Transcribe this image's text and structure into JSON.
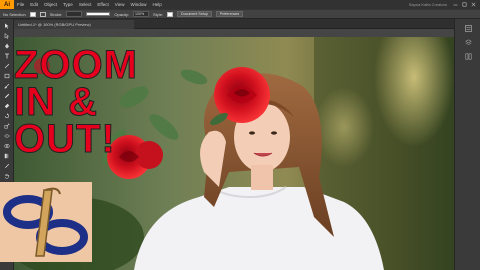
{
  "menubar": {
    "app_logo": "Ai",
    "items": [
      "File",
      "Edit",
      "Object",
      "Type",
      "Select",
      "Effect",
      "View",
      "Window",
      "Help"
    ],
    "workspace": "Sapna Kalfa Creators"
  },
  "controlbar": {
    "selection_label": "No Selection",
    "stroke_label": "Stroke:",
    "opacity_label": "Opacity:",
    "opacity_value": "100%",
    "style_label": "Style:",
    "document_setup": "Document Setup",
    "preferences": "Preferences"
  },
  "document_tab": {
    "label": "Untitled-1* @ 100% (RGB/GPU Preview)"
  },
  "overlay": {
    "line1": "ZOOM",
    "line2": "IN &",
    "line3": "OUT!"
  },
  "colors": {
    "title_red": "#e6001e",
    "logo_bg": "#f0c7a4",
    "logo_navy": "#1d2f86",
    "logo_tan": "#d2a45c",
    "app_orange": "#ff9a00"
  },
  "icons": [
    "selection-tool-icon",
    "direct-selection-tool-icon",
    "pen-tool-icon",
    "type-tool-icon",
    "line-tool-icon",
    "rectangle-tool-icon",
    "paintbrush-tool-icon",
    "pencil-tool-icon",
    "eraser-tool-icon",
    "rotate-tool-icon",
    "scale-tool-icon",
    "width-tool-icon",
    "shape-builder-icon",
    "gradient-tool-icon",
    "eyedropper-tool-icon",
    "hand-tool-icon",
    "zoom-tool-icon"
  ]
}
